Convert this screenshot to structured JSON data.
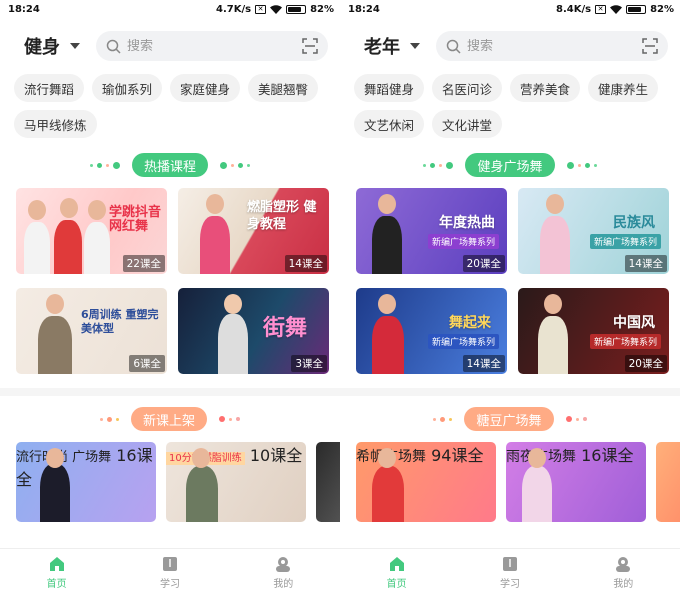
{
  "screens": [
    {
      "status": {
        "time": "18:24",
        "speed": "4.7K/s",
        "battery": "82%",
        "battery_level": 0.82
      },
      "header": {
        "category": "健身",
        "search_placeholder": "搜索"
      },
      "chips": [
        "流行舞蹈",
        "瑜伽系列",
        "家庭健身",
        "美腿翘臀",
        "马甲线修炼"
      ],
      "section1": {
        "title": "热播课程"
      },
      "cards": [
        {
          "title": "学跳抖音网红舞",
          "count": "22课全"
        },
        {
          "title": "燃脂塑形 健身教程",
          "count": "14课全"
        },
        {
          "title": "6周训练 重塑完美体型",
          "count": "6课全"
        },
        {
          "title": "街舞",
          "count": "3课全"
        }
      ],
      "section2": {
        "title": "新课上架"
      },
      "hcards": [
        {
          "title": "流行时尚 广场舞",
          "count": "16课全"
        },
        {
          "title": "10分钟燃脂训练",
          "count": "10课全"
        }
      ]
    },
    {
      "status": {
        "time": "18:24",
        "speed": "8.4K/s",
        "battery": "82%",
        "battery_level": 0.82
      },
      "header": {
        "category": "老年",
        "search_placeholder": "搜索"
      },
      "chips": [
        "舞蹈健身",
        "名医问诊",
        "营养美食",
        "健康养生",
        "文艺休闲",
        "文化讲堂"
      ],
      "section1": {
        "title": "健身广场舞"
      },
      "cards": [
        {
          "title": "年度热曲",
          "subtitle": "新编广场舞系列",
          "count": "20课全"
        },
        {
          "title": "民族风",
          "subtitle": "新编广场舞系列",
          "count": "14课全"
        },
        {
          "title": "舞起来",
          "subtitle": "新编广场舞系列",
          "count": "14课全"
        },
        {
          "title": "中国风",
          "subtitle": "新编广场舞系列",
          "count": "20课全"
        }
      ],
      "section2": {
        "title": "糖豆广场舞"
      },
      "hcards": [
        {
          "title": "希帆广场舞",
          "count": "94课全"
        },
        {
          "title": "雨夜广场舞",
          "count": "16课全"
        }
      ]
    }
  ],
  "tabs": [
    {
      "label": "首页",
      "icon": "home-icon",
      "active": true
    },
    {
      "label": "学习",
      "icon": "book-icon",
      "active": false
    },
    {
      "label": "我的",
      "icon": "profile-icon",
      "active": false
    }
  ],
  "colors": {
    "accent": "#43c97f",
    "orange": "#ffab85"
  }
}
